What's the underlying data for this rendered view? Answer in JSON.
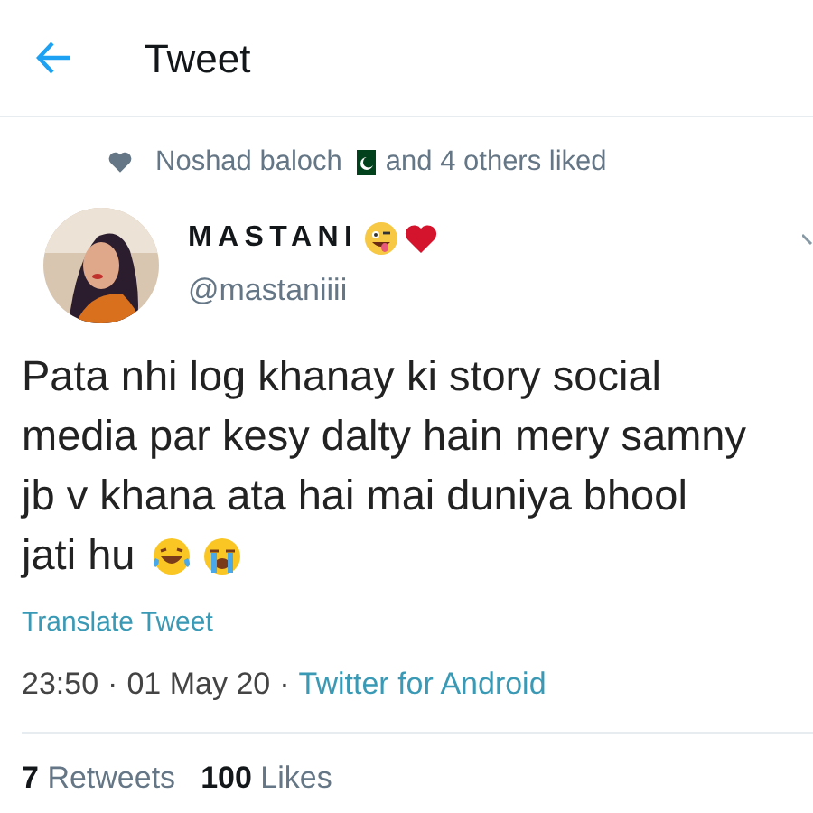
{
  "header": {
    "title": "Tweet"
  },
  "social_context": {
    "name": "Noshad baloch",
    "suffix": "and 4 others liked"
  },
  "author": {
    "display_name": "MASTANI",
    "handle": "@mastaniiii"
  },
  "tweet": {
    "lines": [
      "Pata nhi log khanay ki story social",
      "media par kesy dalty hain mery samny",
      "jb v khana ata hai mai duniya bhool",
      "jati hu"
    ]
  },
  "translate": "Translate Tweet",
  "meta": {
    "time": "23:50",
    "date": "01 May 20",
    "separator": "·",
    "source": "Twitter for Android"
  },
  "stats": [
    {
      "count": "7",
      "label": "Retweets"
    },
    {
      "count": "100",
      "label": "Likes"
    }
  ]
}
